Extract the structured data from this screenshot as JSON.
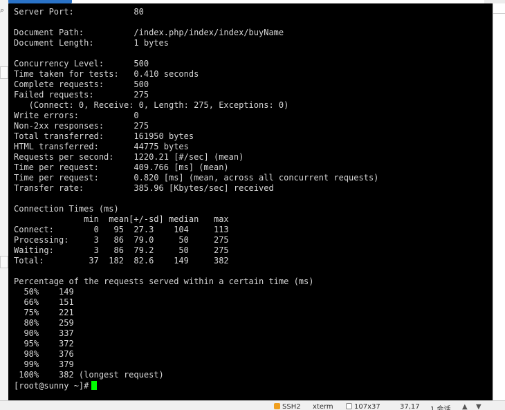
{
  "terminal": {
    "lines": [
      "Server Port:            80",
      "",
      "Document Path:          /index.php/index/index/buyName",
      "Document Length:        1 bytes",
      "",
      "Concurrency Level:      500",
      "Time taken for tests:   0.410 seconds",
      "Complete requests:      500",
      "Failed requests:        275",
      "   (Connect: 0, Receive: 0, Length: 275, Exceptions: 0)",
      "Write errors:           0",
      "Non-2xx responses:      275",
      "Total transferred:      161950 bytes",
      "HTML transferred:       44775 bytes",
      "Requests per second:    1220.21 [#/sec] (mean)",
      "Time per request:       409.766 [ms] (mean)",
      "Time per request:       0.820 [ms] (mean, across all concurrent requests)",
      "Transfer rate:          385.96 [Kbytes/sec] received",
      "",
      "Connection Times (ms)",
      "              min  mean[+/-sd] median   max",
      "Connect:        0   95  27.3    104     113",
      "Processing:     3   86  79.0     50     275",
      "Waiting:        3   86  79.2     50     275",
      "Total:         37  182  82.6    149     382",
      "",
      "Percentage of the requests served within a certain time (ms)",
      "  50%    149",
      "  66%    151",
      "  75%    221",
      "  80%    259",
      "  90%    337",
      "  95%    372",
      "  98%    376",
      "  99%    379",
      " 100%    382 (longest request)"
    ],
    "prompt": "[root@sunny ~]#",
    "cursor_color": "#00ff00",
    "background": "#000000",
    "foreground": "#d8d8d8"
  },
  "statusbar": {
    "protocol": "SSH2",
    "terminal_type": "xterm",
    "size": "107x37",
    "cursor_pos": "37,17",
    "sessions": "1 会话"
  },
  "icons": {
    "search": "search-icon",
    "lock": "lock-icon",
    "size": "grid-icon",
    "arrows": [
      "arrow-up-icon",
      "arrow-down-icon"
    ]
  }
}
